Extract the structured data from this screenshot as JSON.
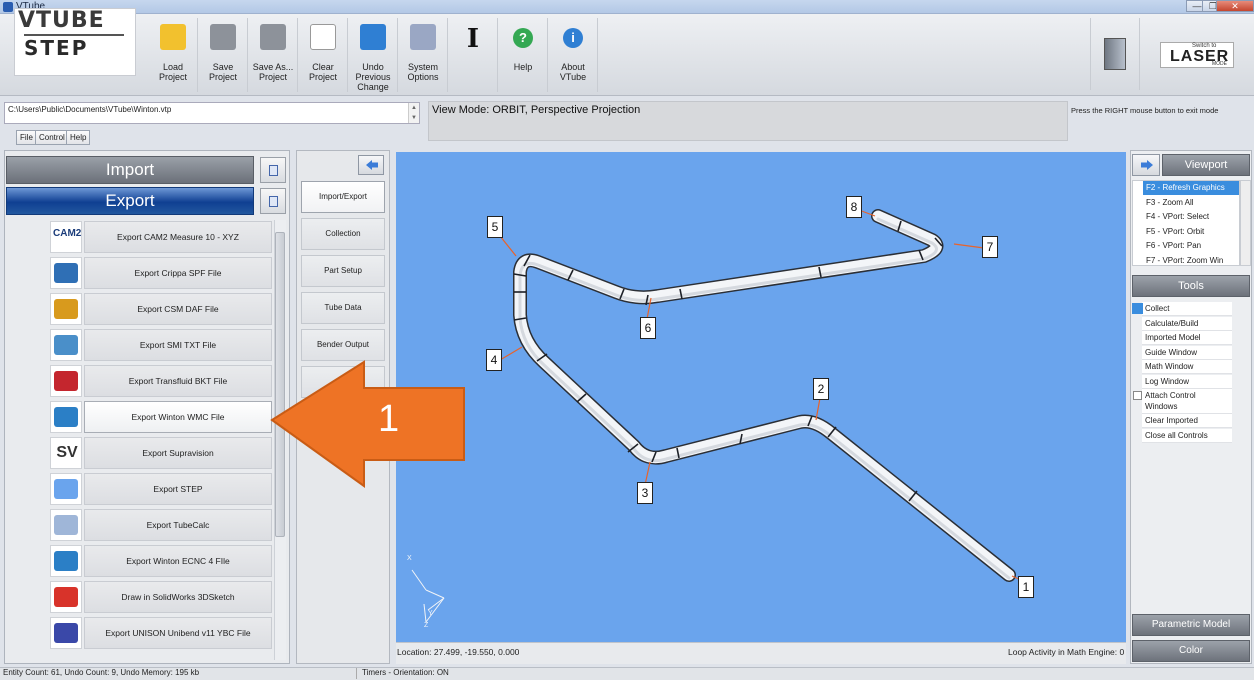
{
  "window": {
    "title": "VTube",
    "min_glyph": "—",
    "max_glyph": "❐",
    "close_glyph": "✕"
  },
  "logo": {
    "line1": "VTUBE",
    "line2": "STEP"
  },
  "toolbar": {
    "buttons": [
      {
        "id": "load-project",
        "label": "Load Project",
        "icon": "folder-open-icon"
      },
      {
        "id": "save-project",
        "label": "Save Project",
        "icon": "save-icon"
      },
      {
        "id": "save-as-project",
        "label": "Save As... Project",
        "icon": "save-as-icon"
      },
      {
        "id": "clear-project",
        "label": "Clear Project",
        "icon": "new-document-icon"
      },
      {
        "id": "undo",
        "label": "Undo Previous Change",
        "icon": "undo-icon"
      },
      {
        "id": "system-options",
        "label": "System Options",
        "icon": "gear-icon"
      },
      {
        "id": "cursor",
        "label": "",
        "icon": "text-cursor-icon",
        "glyph": "I"
      },
      {
        "id": "help",
        "label": "Help",
        "icon": "help-icon",
        "glyph": "?"
      },
      {
        "id": "about",
        "label": "About VTube",
        "icon": "info-icon",
        "glyph": "i"
      }
    ],
    "laser": {
      "small": "Switch to",
      "big": "LASER",
      "mode": "MODE"
    }
  },
  "path": {
    "value": "C:\\Users\\Public\\Documents\\VTube\\Winton.vtp",
    "scroll_up": "▲",
    "scroll_down": "▼"
  },
  "view_mode": "View Mode: ORBIT, Perspective Projection",
  "rmb_note": "Press the RIGHT mouse button to exit mode",
  "menu": [
    "File",
    "Control",
    "Help"
  ],
  "left": {
    "import_label": "Import",
    "export_label": "Export",
    "exports": [
      {
        "label": "Export CAM2 Measure 10 - XYZ",
        "icon": "cam2-icon",
        "icon_text": "CAM2",
        "color": "#1b3c7a"
      },
      {
        "label": "Export Crippa SPF File",
        "icon": "crippa-machine-icon",
        "color": "#2f6fb5"
      },
      {
        "label": "Export CSM DAF File",
        "icon": "csm-machine-icon",
        "color": "#d89a1d"
      },
      {
        "label": "Export SMI TXT File",
        "icon": "smi-machine-icon",
        "color": "#4a8fc9"
      },
      {
        "label": "Export Transfluid BKT File",
        "icon": "transfluid-machine-icon",
        "color": "#c4262e"
      },
      {
        "label": "Export Winton WMC File",
        "icon": "winton-machine-icon",
        "color": "#2b7fc6",
        "selected": true
      },
      {
        "label": "Export Supravision",
        "icon": "supravision-icon",
        "icon_text": "SV",
        "color": "#333333"
      },
      {
        "label": "Export STEP",
        "icon": "step-wave-icon",
        "color": "#6aa4ed"
      },
      {
        "label": "Export TubeCalc",
        "icon": "tubecalc-icon",
        "color": "#9fb6d8"
      },
      {
        "label": "Export Winton ECNC 4 FIle",
        "icon": "winton-ecnc-icon",
        "color": "#2b7fc6"
      },
      {
        "label": "Draw in SolidWorks 3DSketch",
        "icon": "solidworks-icon",
        "color": "#d8332a"
      },
      {
        "label": "Export UNISON Unibend v11 YBC File",
        "icon": "unison-machine-icon",
        "color": "#3a48a8"
      }
    ]
  },
  "nav": {
    "items": [
      {
        "label": "Import/Export",
        "active": true
      },
      {
        "label": "Collection"
      },
      {
        "label": "Part Setup"
      },
      {
        "label": "Tube Data"
      },
      {
        "label": "Bender Output"
      },
      {
        "label": ""
      }
    ]
  },
  "viewport": {
    "location": "Location: 27.499, -19.550, 0.000",
    "loop_activity": "Loop Activity in Math Engine:  0",
    "markers": [
      "1",
      "2",
      "3",
      "4",
      "5",
      "6",
      "7",
      "8"
    ],
    "axis_labels": {
      "x": "X",
      "y": "Y",
      "z": "Z"
    },
    "bg_color": "#6aa4ed"
  },
  "right": {
    "viewport_label": "Viewport",
    "viewport_items": [
      "F2 - Refresh Graphics",
      "F3 - Zoom All",
      "F4 - VPort: Select",
      "F5 - VPort: Orbit",
      "F6 - VPort: Pan",
      "F7 - VPort: Zoom Win"
    ],
    "tools_label": "Tools",
    "tools": [
      "Collect",
      "Calculate/Build",
      "Imported Model",
      "Guide Window",
      "Math Window",
      "Log Window",
      "Attach Control Windows",
      "Clear Imported",
      "Close all Controls"
    ],
    "parametric_label": "Parametric Model",
    "color_label": "Color"
  },
  "status": {
    "left": "Entity Count: 61, Undo Count: 9, Undo Memory: 195 kb",
    "mid": "Timers - Orientation: ON"
  },
  "callout": {
    "number": "1",
    "color": "#ee7325"
  }
}
